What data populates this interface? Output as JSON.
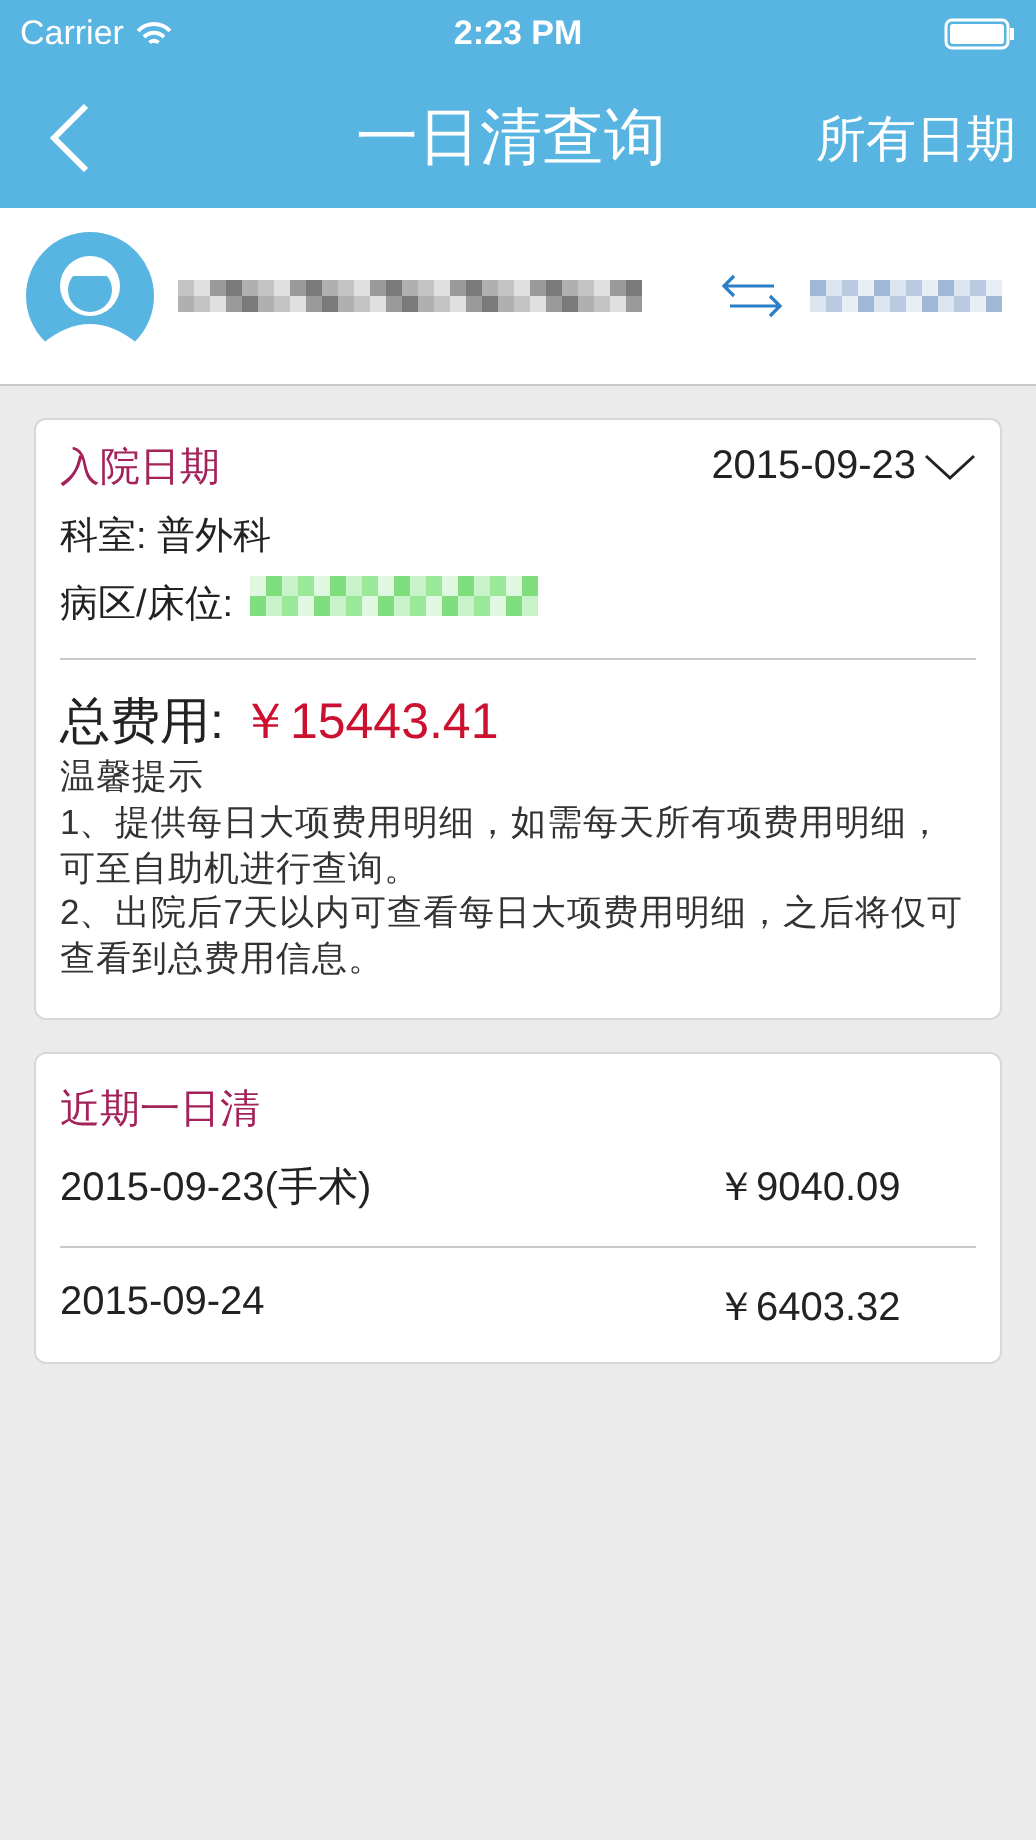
{
  "status_bar": {
    "carrier": "Carrier",
    "time": "2:23 PM"
  },
  "nav": {
    "title": "一日清查询",
    "action": "所有日期"
  },
  "patient": {
    "kind": "redacted"
  },
  "admission": {
    "label": "入院日期",
    "date": "2015-09-23",
    "department": "科室: 普外科",
    "ward_label": "病区/床位:",
    "total_label": "总费用:",
    "total": "￥15443.41",
    "tips_title": "温馨提示",
    "tips": [
      "1、提供每日大项费用明细，如需每天所有项费用明细，可至自助机进行查询。",
      "2、出院后7天以内可查看每日大项费用明细，之后将仅可查看到总费用信息。"
    ]
  },
  "recent": {
    "title": "近期一日清",
    "rows": [
      {
        "date": "2015-09-23(手术)",
        "amount": "￥9040.09"
      },
      {
        "date": "2015-09-24",
        "amount": "￥6403.32"
      }
    ]
  }
}
